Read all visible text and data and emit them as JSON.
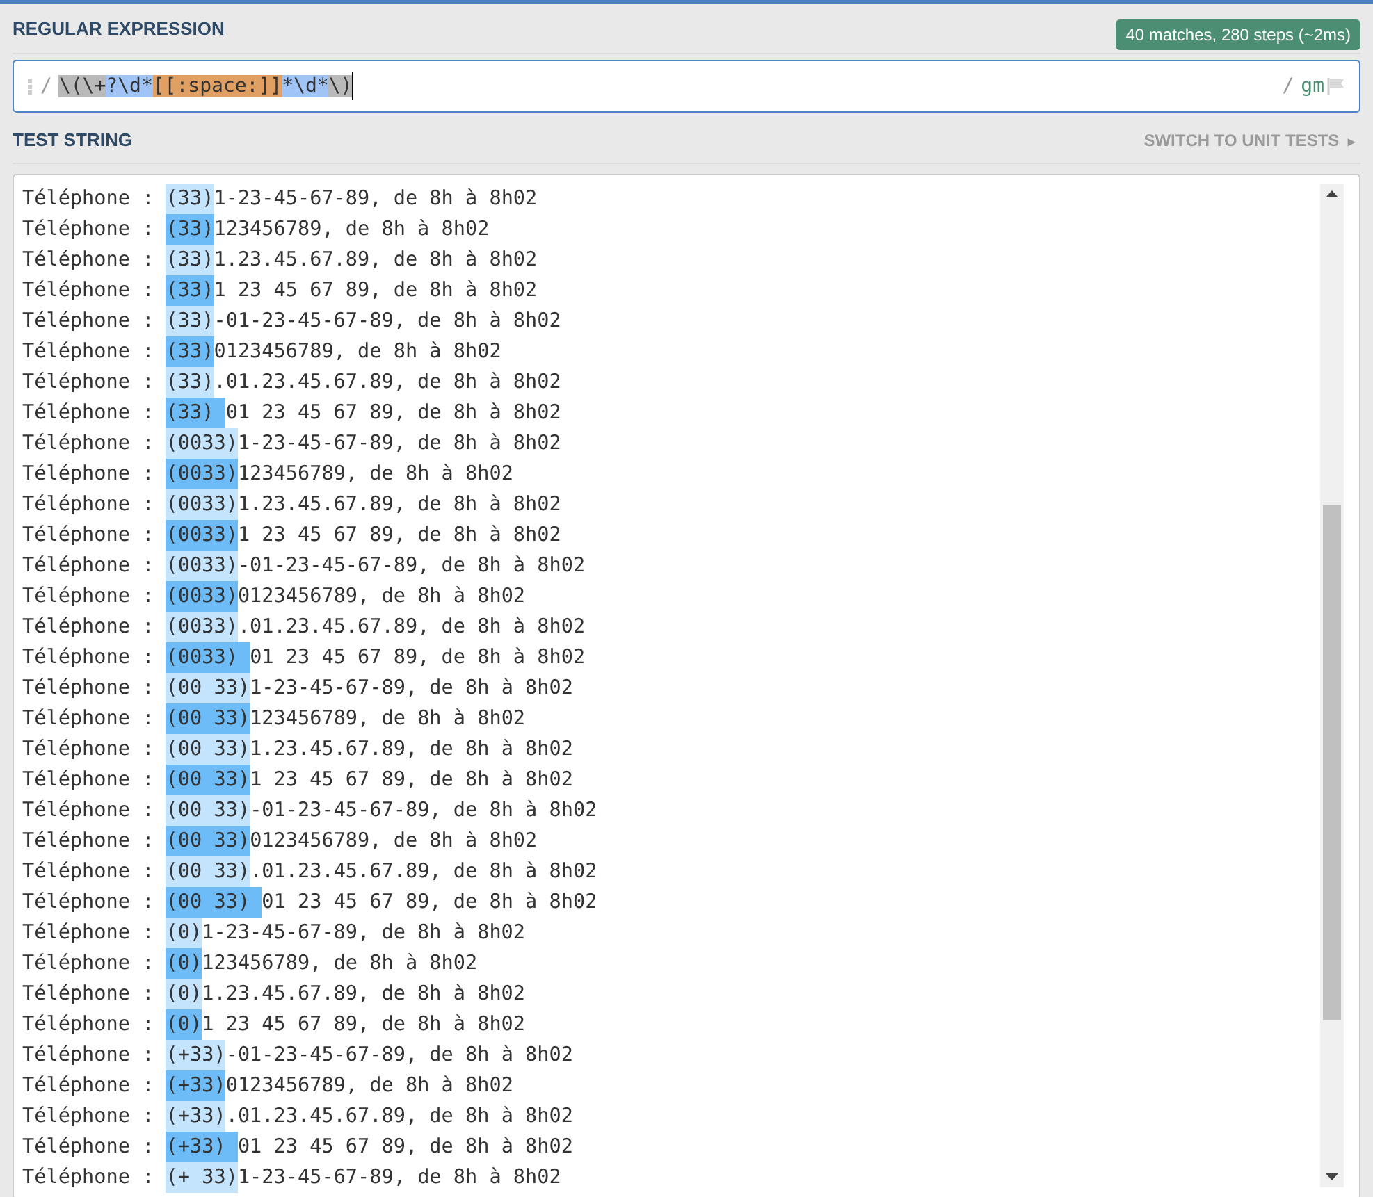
{
  "regex_section": {
    "title": "REGULAR EXPRESSION",
    "badge": "40 matches, 280 steps (~2ms)",
    "delimiter_open": "/",
    "tokens": [
      {
        "text": "\\(\\+",
        "kind": "escape"
      },
      {
        "text": "?\\d*",
        "kind": "quantifier"
      },
      {
        "text": "[[:space:]]",
        "kind": "class"
      },
      {
        "text": "*\\d*",
        "kind": "quantifier"
      },
      {
        "text": "\\)",
        "kind": "escape"
      }
    ],
    "delimiter_close": "/",
    "flags": "gm"
  },
  "test_section": {
    "title": "TEST STRING",
    "switch_link": "SWITCH TO UNIT TESTS",
    "switch_arrow": "▸",
    "lines": [
      {
        "before": "Téléphone : ",
        "match": "(33)",
        "kind": "light",
        "after": "1-23-45-67-89, de 8h à 8h02"
      },
      {
        "before": "Téléphone : ",
        "match": "(33)",
        "kind": "dark",
        "after": "123456789, de 8h à 8h02"
      },
      {
        "before": "Téléphone : ",
        "match": "(33)",
        "kind": "light",
        "after": "1.23.45.67.89, de 8h à 8h02"
      },
      {
        "before": "Téléphone : ",
        "match": "(33)",
        "kind": "dark",
        "after": "1 23 45 67 89, de 8h à 8h02"
      },
      {
        "before": "Téléphone : ",
        "match": "(33)",
        "kind": "light",
        "after": "-01-23-45-67-89, de 8h à 8h02"
      },
      {
        "before": "Téléphone : ",
        "match": "(33)",
        "kind": "dark",
        "after": "0123456789, de 8h à 8h02"
      },
      {
        "before": "Téléphone : ",
        "match": "(33)",
        "kind": "light",
        "after": ".01.23.45.67.89, de 8h à 8h02"
      },
      {
        "before": "Téléphone : ",
        "match": "(33) ",
        "kind": "dark",
        "after": "01 23 45 67 89, de 8h à 8h02"
      },
      {
        "before": "Téléphone : ",
        "match": "(0033)",
        "kind": "light",
        "after": "1-23-45-67-89, de 8h à 8h02"
      },
      {
        "before": "Téléphone : ",
        "match": "(0033)",
        "kind": "dark",
        "after": "123456789, de 8h à 8h02"
      },
      {
        "before": "Téléphone : ",
        "match": "(0033)",
        "kind": "light",
        "after": "1.23.45.67.89, de 8h à 8h02"
      },
      {
        "before": "Téléphone : ",
        "match": "(0033)",
        "kind": "dark",
        "after": "1 23 45 67 89, de 8h à 8h02"
      },
      {
        "before": "Téléphone : ",
        "match": "(0033)",
        "kind": "light",
        "after": "-01-23-45-67-89, de 8h à 8h02"
      },
      {
        "before": "Téléphone : ",
        "match": "(0033)",
        "kind": "dark",
        "after": "0123456789, de 8h à 8h02"
      },
      {
        "before": "Téléphone : ",
        "match": "(0033)",
        "kind": "light",
        "after": ".01.23.45.67.89, de 8h à 8h02"
      },
      {
        "before": "Téléphone : ",
        "match": "(0033) ",
        "kind": "dark",
        "after": "01 23 45 67 89, de 8h à 8h02"
      },
      {
        "before": "Téléphone : ",
        "match": "(00 33)",
        "kind": "light",
        "after": "1-23-45-67-89, de 8h à 8h02"
      },
      {
        "before": "Téléphone : ",
        "match": "(00 33)",
        "kind": "dark",
        "after": "123456789, de 8h à 8h02"
      },
      {
        "before": "Téléphone : ",
        "match": "(00 33)",
        "kind": "light",
        "after": "1.23.45.67.89, de 8h à 8h02"
      },
      {
        "before": "Téléphone : ",
        "match": "(00 33)",
        "kind": "dark",
        "after": "1 23 45 67 89, de 8h à 8h02"
      },
      {
        "before": "Téléphone : ",
        "match": "(00 33)",
        "kind": "light",
        "after": "-01-23-45-67-89, de 8h à 8h02"
      },
      {
        "before": "Téléphone : ",
        "match": "(00 33)",
        "kind": "dark",
        "after": "0123456789, de 8h à 8h02"
      },
      {
        "before": "Téléphone : ",
        "match": "(00 33)",
        "kind": "light",
        "after": ".01.23.45.67.89, de 8h à 8h02"
      },
      {
        "before": "Téléphone : ",
        "match": "(00 33) ",
        "kind": "dark",
        "after": "01 23 45 67 89, de 8h à 8h02"
      },
      {
        "before": "Téléphone : ",
        "match": "(0)",
        "kind": "light",
        "after": "1-23-45-67-89, de 8h à 8h02"
      },
      {
        "before": "Téléphone : ",
        "match": "(0)",
        "kind": "dark",
        "after": "123456789, de 8h à 8h02"
      },
      {
        "before": "Téléphone : ",
        "match": "(0)",
        "kind": "light",
        "after": "1.23.45.67.89, de 8h à 8h02"
      },
      {
        "before": "Téléphone : ",
        "match": "(0)",
        "kind": "dark",
        "after": "1 23 45 67 89, de 8h à 8h02"
      },
      {
        "before": "Téléphone : ",
        "match": "(+33)",
        "kind": "light",
        "after": "-01-23-45-67-89, de 8h à 8h02"
      },
      {
        "before": "Téléphone : ",
        "match": "(+33)",
        "kind": "dark",
        "after": "0123456789, de 8h à 8h02"
      },
      {
        "before": "Téléphone : ",
        "match": "(+33)",
        "kind": "light",
        "after": ".01.23.45.67.89, de 8h à 8h02"
      },
      {
        "before": "Téléphone : ",
        "match": "(+33) ",
        "kind": "dark",
        "after": "01 23 45 67 89, de 8h à 8h02"
      },
      {
        "before": "Téléphone : ",
        "match": "(+ 33)",
        "kind": "light",
        "after": "1-23-45-67-89, de 8h à 8h02"
      }
    ]
  }
}
